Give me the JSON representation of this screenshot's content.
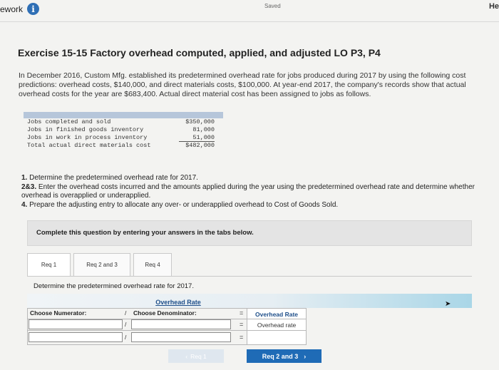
{
  "topbar": {
    "left_text": "ework",
    "saved": "Saved",
    "right_text": "He"
  },
  "title": "Exercise 15-15 Factory overhead computed, applied, and adjusted LO P3, P4",
  "intro": "In December 2016, Custom Mfg. established its predetermined overhead rate for jobs produced during 2017 by using the following cost predictions: overhead costs, $140,000, and direct materials costs, $100,000. At year-end 2017, the company's records show that actual overhead costs for the year are $683,400. Actual direct material cost has been assigned to jobs as follows.",
  "data_table": {
    "rows": [
      {
        "label": "Jobs completed and sold",
        "value": "$350,000"
      },
      {
        "label": "Jobs in finished goods inventory",
        "value": "81,000"
      },
      {
        "label": "Jobs in work in process inventory",
        "value": "51,000"
      },
      {
        "label": "Total actual direct materials cost",
        "value": "$482,000"
      }
    ]
  },
  "questions": {
    "q1_num": "1.",
    "q1": "Determine the predetermined overhead rate for 2017.",
    "q2_num": "2&3.",
    "q2": "Enter the overhead costs incurred and the amounts applied during the year using the predetermined overhead rate and determine whether overhead is overapplied or underapplied.",
    "q4_num": "4.",
    "q4": "Prepare the adjusting entry to allocate any over- or underapplied overhead to Cost of Goods Sold."
  },
  "complete_text": "Complete this question by entering your answers in the tabs below.",
  "tabs": [
    {
      "label": "Req 1"
    },
    {
      "label": "Req 2 and 3"
    },
    {
      "label": "Req 4"
    }
  ],
  "prompt": "Determine the predetermined overhead rate for 2017.",
  "grid": {
    "header": "Overhead Rate",
    "numerator_label": "Choose Numerator:",
    "slash": "/",
    "denominator_label": "Choose Denominator:",
    "equals": "=",
    "result_header": "Overhead Rate",
    "result_label": "Overhead rate"
  },
  "nav": {
    "prev": "Req 1",
    "next": "Req 2 and 3"
  },
  "colors": {
    "accent": "#1f6bb6",
    "header_link": "#1f4f8a",
    "table_header": "#b6c6da"
  }
}
